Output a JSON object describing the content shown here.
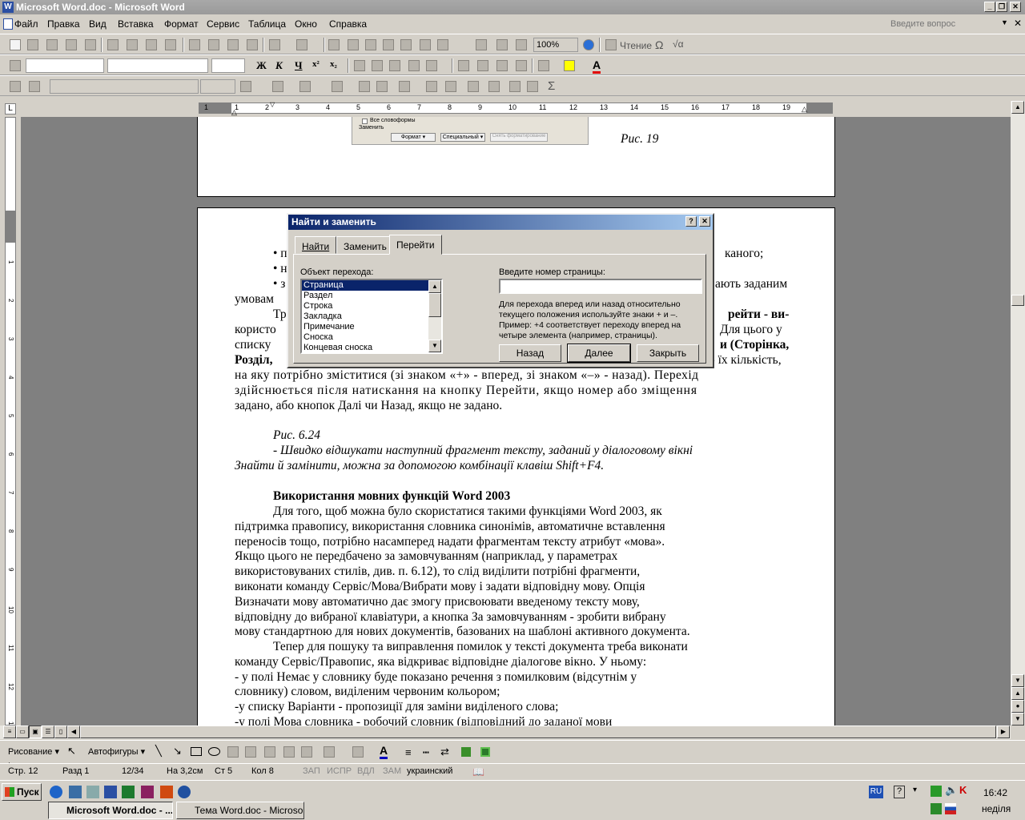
{
  "window": {
    "title": "Microsoft Word.doc - Microsoft Word",
    "help_placeholder": "Введите вопрос"
  },
  "menu": [
    "Файл",
    "Правка",
    "Вид",
    "Вставка",
    "Формат",
    "Сервис",
    "Таблица",
    "Окно",
    "Справка"
  ],
  "toolbar": {
    "zoom": "100%",
    "read_label": "Чтение"
  },
  "format_bar": {
    "bold": "Ж",
    "italic": "К",
    "underline": "Ч"
  },
  "ruler": {
    "numbers": [
      "1",
      "1",
      "2",
      "3",
      "4",
      "5",
      "6",
      "7",
      "8",
      "9",
      "10",
      "11",
      "12",
      "13",
      "14",
      "15",
      "16",
      "17",
      "18",
      "19"
    ],
    "vnumbers": [
      "1",
      "2",
      "3",
      "4",
      "5",
      "6",
      "7",
      "8",
      "9",
      "10",
      "11",
      "12",
      "13",
      "14",
      "15"
    ]
  },
  "page1": {
    "mini_check": "Все словоформы",
    "mini_replace": "Заменить",
    "mini_btn1": "Формат ▾",
    "mini_btn2": "Специальный ▾",
    "mini_btn3": "Снять форматирование",
    "caption": "Рис. 19"
  },
  "page2": {
    "bul1": "•  п",
    "bul1_end": "каного;",
    "bul2": "•  н",
    "bul3": "•  з",
    "bul3_end": "ають заданим",
    "l_umov": "умовам",
    "l_tr": "Тр",
    "l_tr_end": "рейти - ви-",
    "l_kor": "користо",
    "l_kor_end": "Для цього у",
    "l_sp": "списку",
    "l_sp_end": "и (Сторінка,",
    "l_roz": "Розділ,",
    "l_roz_end": "о їх кількість,",
    "l5": "на яку потрібно зміститися (зі знаком «+» - вперед, зі знаком «–» - назад). Перехід",
    "l6": "здійснюється після натискання на кнопку Перейти, якщо номер або зміщення",
    "l7": "задано, або кнопок Далі чи Назад, якщо не задано.",
    "fig": "Рис. 6.24",
    "i1": "- Швидко відшукати наступний фрагмент тексту, заданий у діалоговому вікні",
    "i2": "Знайти й замінити, можна за допомогою комбінації клавіш Shift+F4.",
    "heading": "Використання мовних функцій Word 2003",
    "p1": [
      "Для того, щоб можна було скористатися такими функціями Word 2003, як",
      "підтримка правопису, використання словника синонімів, автоматичне вставлення",
      "переносів тощо, потрібно насамперед надати фрагментам тексту атрибут «мова».",
      "Якщо цього не передбачено за замовчуванням (наприклад, у параметрах",
      "використовуваних стилів, див. п. 6.12), то слід виділити потрібні фрагменти,",
      "виконати команду Сервіс/Мова/Вибрати мову і задати відповідну мову. Опція",
      "Визначати мову автоматично дає змогу присвоювати введеному тексту мову,",
      "відповідну до вибраної клавіатури, а кнопка За замовчуванням - зробити вибрану",
      "мову стандартною для нових документів, базованих на шаблоні активного документа."
    ],
    "p2": [
      "Тепер для пошуку та виправлення помилок у тексті документа треба виконати",
      "команду Сервіс/Правопис, яка відкриває відповідне діалогове вікно. У ньому:",
      "- у полі Немає у словнику буде показано речення з помилковим (відсутнім у",
      "словнику) словом, виділеним червоним кольором;",
      "-у списку Варіанти - пропозиції для заміни виділеного слова;",
      "-у полі Мова словника - робочий словник (відповідний до заданої мови"
    ]
  },
  "dialog": {
    "title": "Найти и заменить",
    "help": "?",
    "close": "✕",
    "tabs": [
      "Найти",
      "Заменить",
      "Перейти"
    ],
    "object_label": "Объект перехода:",
    "objects": [
      "Страница",
      "Раздел",
      "Строка",
      "Закладка",
      "Примечание",
      "Сноска",
      "Концевая сноска"
    ],
    "page_label": "Введите номер страницы:",
    "page_value": "",
    "hint": [
      "Для перехода вперед или назад относительно",
      "текущего положения используйте знаки + и –.",
      "Пример: +4 соответствует переходу вперед на",
      "четыре элемента (например, страницы)."
    ],
    "btn_back": "Назад",
    "btn_next": "Далее",
    "btn_close": "Закрыть"
  },
  "drawbar": {
    "draw": "Рисование ▾",
    "autoshapes": "Автофигуры ▾"
  },
  "status": {
    "page": "Стр. 12",
    "section": "Разд 1",
    "pages": "12/34",
    "at": "На 3,2см",
    "line": "Ст 5",
    "col": "Кол 8",
    "rec": "ЗАП",
    "trk": "ИСПР",
    "ext": "ВДЛ",
    "ovr": "ЗАМ",
    "lang": "украинский"
  },
  "taskbar": {
    "start": "Пуск",
    "tasks": [
      "Microsoft Word.doc - ...",
      "Тема Word.doc - Microso..."
    ],
    "lang": "RU",
    "time": "16:42",
    "day": "неділя"
  }
}
